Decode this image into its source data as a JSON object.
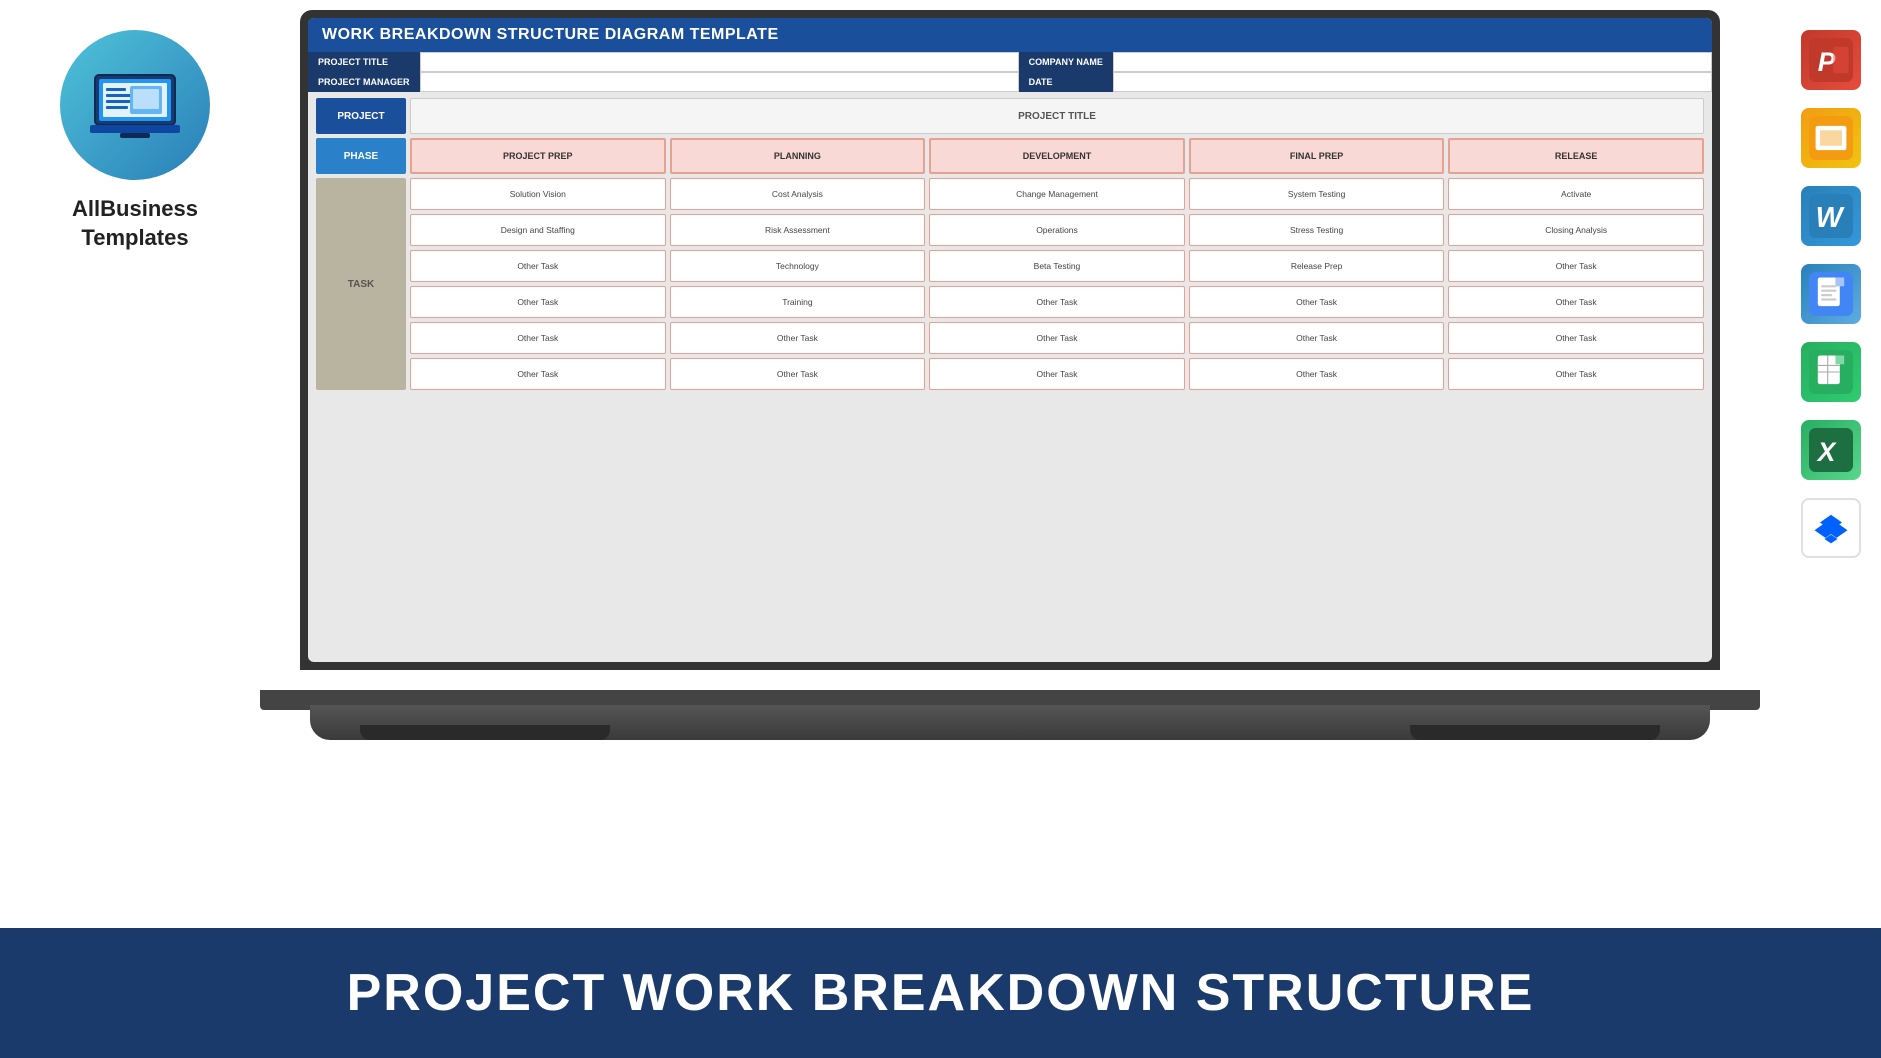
{
  "brand": {
    "name": "AllBusiness\nTemplates",
    "name_line1": "AllBusiness",
    "name_line2": "Templates"
  },
  "bottom_banner": {
    "text": "PROJECT WORK BREAKDOWN STRUCTURE"
  },
  "wbs": {
    "title": "WORK BREAKDOWN STRUCTURE DIAGRAM TEMPLATE",
    "meta": {
      "project_title_label": "PROJECT TITLE",
      "project_manager_label": "PROJECT MANAGER",
      "company_name_label": "COMPANY NAME",
      "date_label": "DATE"
    },
    "project_label": "PROJECT",
    "project_title_placeholder": "PROJECT TITLE",
    "phase_label": "PHASE",
    "task_label": "TASK",
    "phases": [
      "PROJECT PREP",
      "PLANNING",
      "DEVELOPMENT",
      "FINAL PREP",
      "RELEASE"
    ],
    "task_rows": [
      [
        "Solution Vision",
        "Cost Analysis",
        "Change Management",
        "System Testing",
        "Activate"
      ],
      [
        "Design and Staffing",
        "Risk Assessment",
        "Operations",
        "Stress Testing",
        "Closing Analysis"
      ],
      [
        "Other Task",
        "Technology",
        "Beta Testing",
        "Release Prep",
        "Other Task"
      ],
      [
        "Other Task",
        "Training",
        "Other Task",
        "Other Task",
        "Other Task"
      ],
      [
        "Other Task",
        "Other Task",
        "Other Task",
        "Other Task",
        "Other Task"
      ],
      [
        "Other Task",
        "Other Task",
        "Other Task",
        "Other Task",
        "Other Task"
      ]
    ]
  },
  "app_icons": [
    {
      "name": "PowerPoint",
      "letter": "P",
      "class": "icon-powerpoint"
    },
    {
      "name": "Google Slides",
      "letter": "▶",
      "class": "icon-slides"
    },
    {
      "name": "Microsoft Word",
      "letter": "W",
      "class": "icon-word"
    },
    {
      "name": "Google Docs",
      "letter": "≡",
      "class": "icon-docs"
    },
    {
      "name": "Google Sheets",
      "letter": "⊞",
      "class": "icon-sheets"
    },
    {
      "name": "Microsoft Excel",
      "letter": "X",
      "class": "icon-excel"
    },
    {
      "name": "Dropbox",
      "letter": "◆",
      "class": "icon-dropbox"
    }
  ]
}
